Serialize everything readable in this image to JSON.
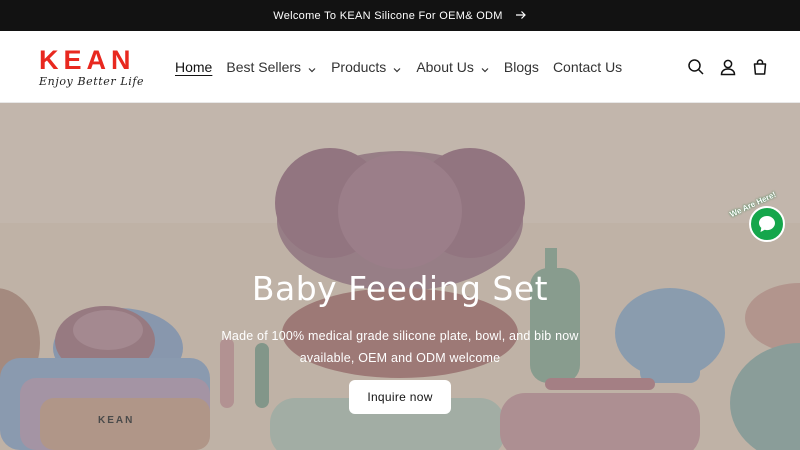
{
  "announcement": {
    "text": "Welcome To KEAN Silicone For OEM& ODM",
    "icon": "arrow-right-icon"
  },
  "logo": {
    "brand": "KEAN",
    "tagline": "Enjoy Better Life",
    "color": "#e8281f"
  },
  "nav": {
    "items": [
      {
        "label": "Home",
        "active": true,
        "dropdown": false
      },
      {
        "label": "Best Sellers",
        "dropdown": true
      },
      {
        "label": "Products",
        "dropdown": true
      },
      {
        "label": "About Us",
        "dropdown": true
      },
      {
        "label": "Blogs",
        "dropdown": false
      },
      {
        "label": "Contact Us",
        "dropdown": false
      }
    ]
  },
  "header_icons": [
    "search-icon",
    "account-icon",
    "cart-icon"
  ],
  "hero": {
    "title": "Baby Feeding Set",
    "subtitle": "Made of 100% medical grade silicone plate, bowl, and bib now available, OEM and ODM welcome",
    "button": "Inquire now",
    "bib_text": "KEAN"
  },
  "chat": {
    "tag": "We Are Here!",
    "color": "#15a64b"
  }
}
